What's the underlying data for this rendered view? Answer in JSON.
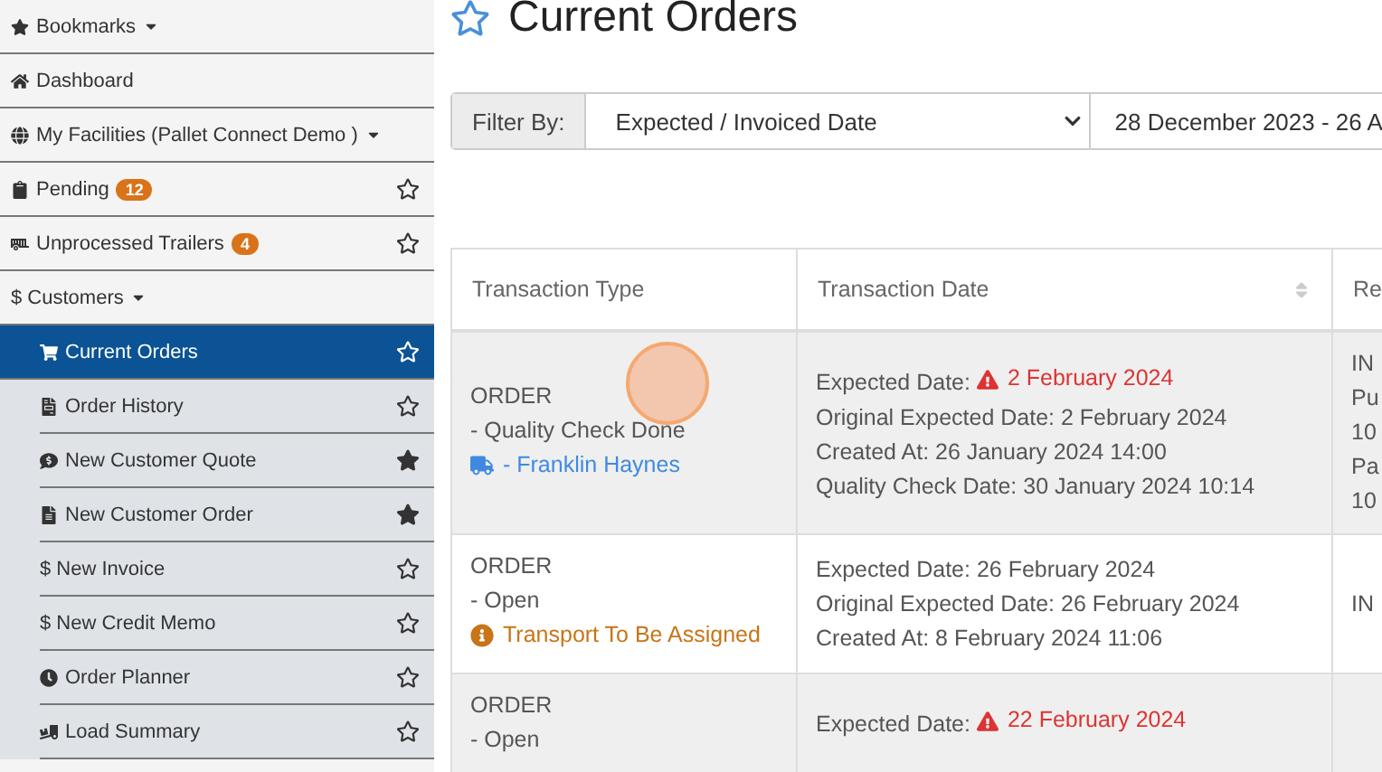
{
  "sidebar": {
    "items": [
      {
        "label": "Bookmarks",
        "dropdown": true,
        "selected": false
      },
      {
        "label": "Dashboard",
        "selected": false
      },
      {
        "label": "My Facilities (Pallet Connect Demo )",
        "dropdown": true,
        "selected": false
      },
      {
        "label": "Pending",
        "badge": "12",
        "starred": false,
        "selected": false
      },
      {
        "label": "Unprocessed Trailers",
        "badge": "4",
        "starred": false,
        "selected": false
      },
      {
        "label": "$ Customers",
        "dropdown": true,
        "selected": false,
        "children": [
          {
            "label": "Current Orders",
            "starred": false,
            "selected": true
          },
          {
            "label": "Order History",
            "starred": false,
            "selected": false
          },
          {
            "label": "New Customer Quote",
            "starred": true,
            "selected": false
          },
          {
            "label": "New Customer Order",
            "starred": true,
            "selected": false
          },
          {
            "label": "$ New Invoice",
            "starred": false,
            "selected": false
          },
          {
            "label": "$ New Credit Memo",
            "starred": false,
            "selected": false
          },
          {
            "label": "Order Planner",
            "starred": false,
            "selected": false
          },
          {
            "label": "Load Summary",
            "starred": false,
            "selected": false
          }
        ]
      }
    ]
  },
  "page": {
    "title": "Current Orders",
    "starred": false
  },
  "filter": {
    "label": "Filter By:",
    "value": "Expected / Invoiced Date",
    "date_range": "28 December 2023 - 26 A"
  },
  "table": {
    "columns": [
      {
        "label": "Transaction Type"
      },
      {
        "label": "Transaction Date",
        "sortable": true
      },
      {
        "label": "Re"
      }
    ],
    "rows": [
      {
        "type": "ORDER",
        "status": "- Quality Check Done",
        "transport": {
          "kind": "driver",
          "text": "- Franklin Haynes"
        },
        "dates": [
          {
            "label": "Expected Date:",
            "value": "2 February 2024",
            "overdue": true
          },
          {
            "label": "Original Expected Date:",
            "value": "2 February 2024",
            "overdue": false
          },
          {
            "label": "Created At:",
            "value": "26 January 2024 14:00",
            "overdue": false
          },
          {
            "label": "Quality Check Date:",
            "value": "30 January 2024 10:14",
            "overdue": false
          }
        ],
        "column_3": [
          "IN",
          "Pu",
          "10",
          "Pa",
          "10"
        ]
      },
      {
        "type": "ORDER",
        "status": "- Open",
        "transport": {
          "kind": "unassigned",
          "text": "Transport To Be Assigned"
        },
        "dates": [
          {
            "label": "Expected Date:",
            "value": "26 February 2024",
            "overdue": false
          },
          {
            "label": "Original Expected Date:",
            "value": "26 February 2024",
            "overdue": false
          },
          {
            "label": "Created At:",
            "value": "8 February 2024 11:06",
            "overdue": false
          }
        ],
        "column_3": [
          "IN"
        ]
      },
      {
        "type": "ORDER",
        "status": "- Open",
        "dates": [
          {
            "label": "Expected Date:",
            "value": "22 February 2024",
            "overdue": true
          }
        ],
        "column_3": []
      }
    ]
  }
}
